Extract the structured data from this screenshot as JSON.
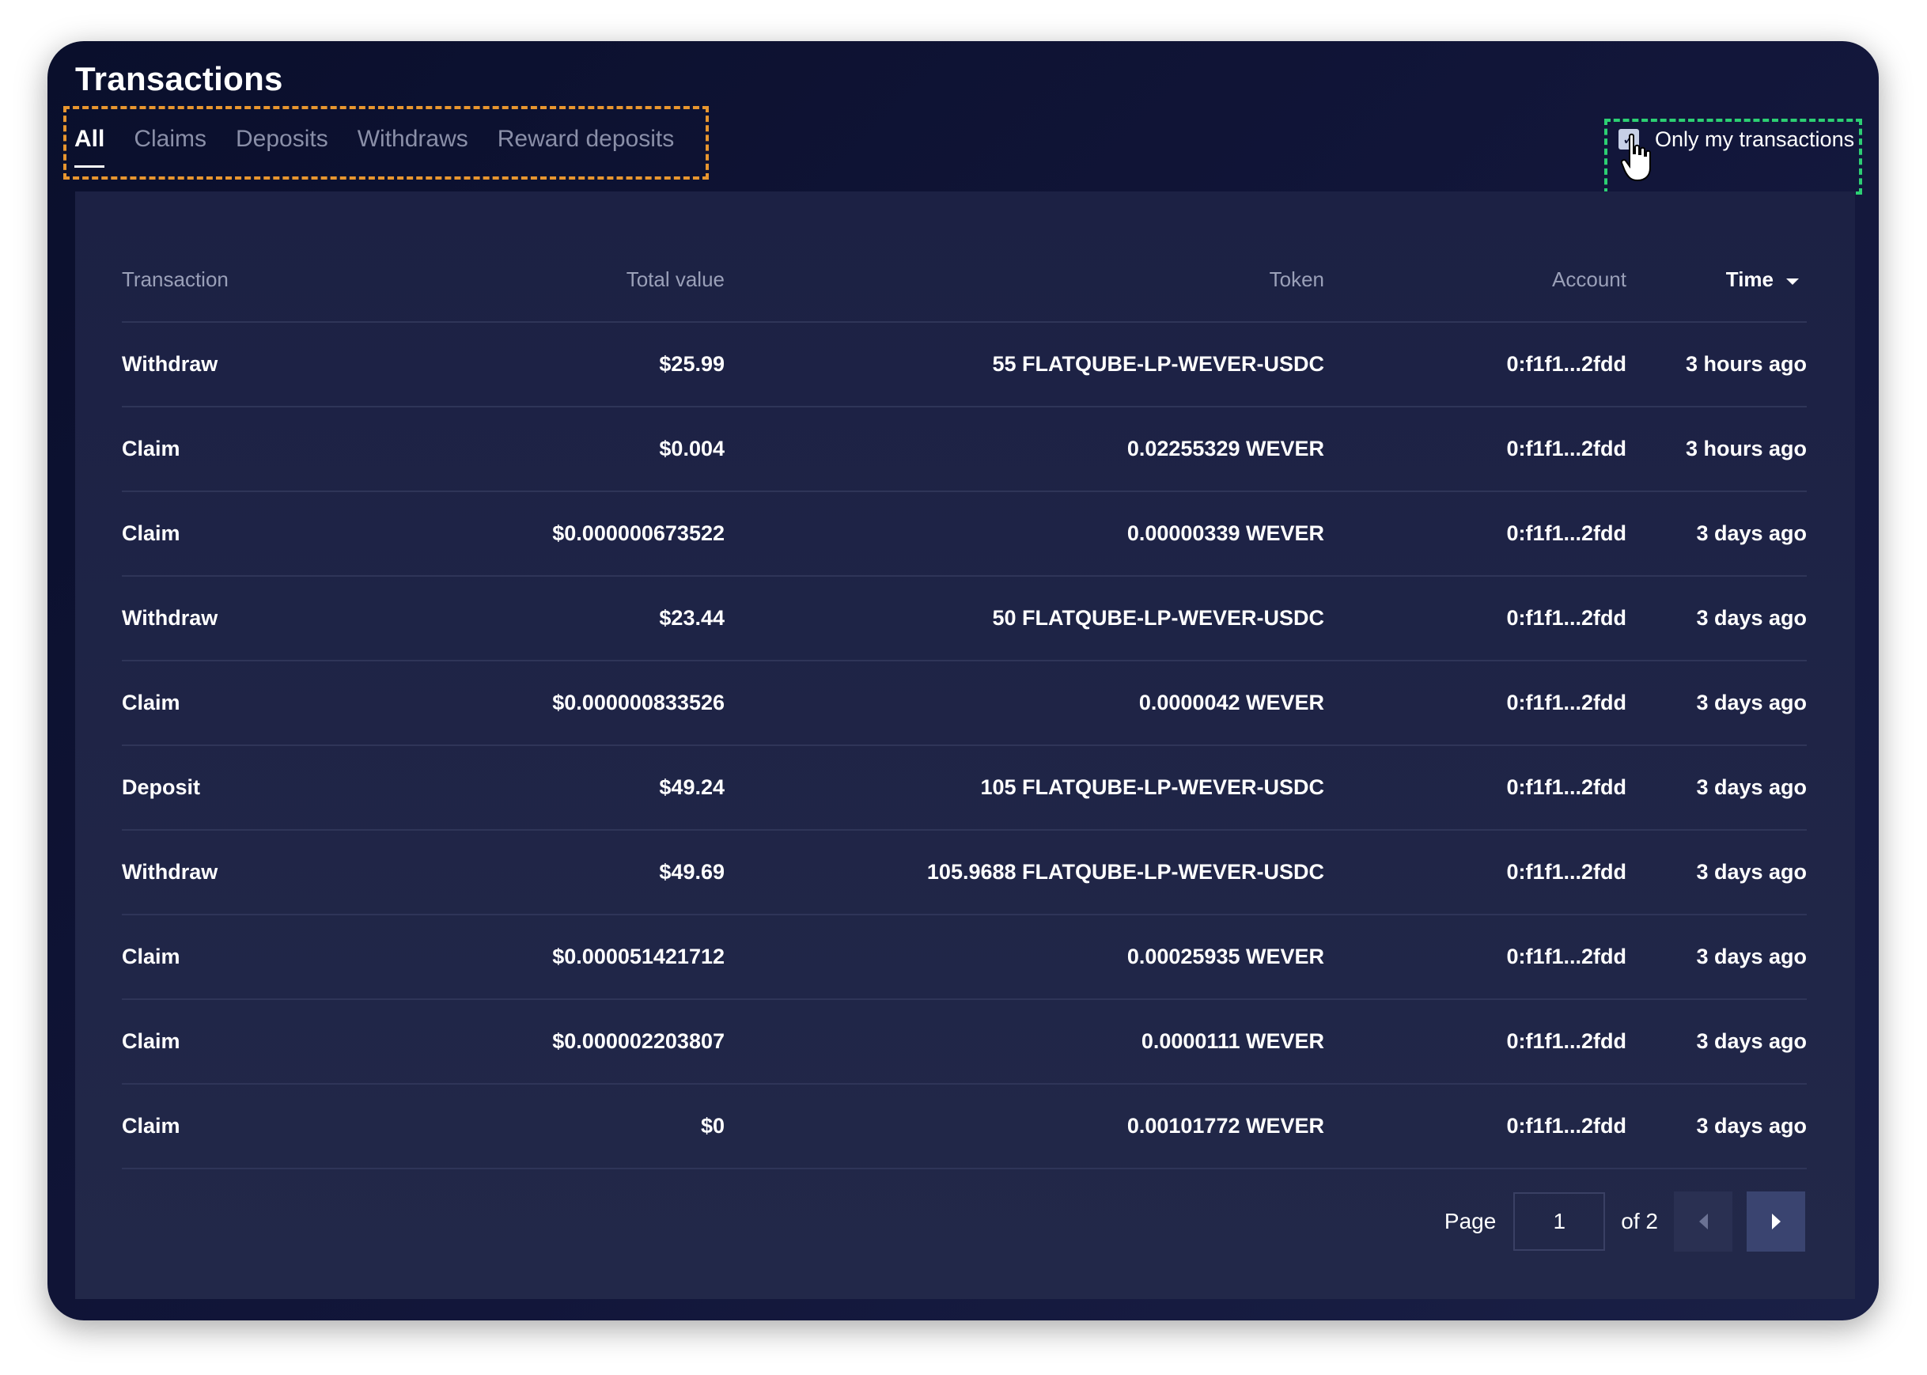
{
  "title": "Transactions",
  "tabs": [
    {
      "label": "All",
      "active": true
    },
    {
      "label": "Claims",
      "active": false
    },
    {
      "label": "Deposits",
      "active": false
    },
    {
      "label": "Withdraws",
      "active": false
    },
    {
      "label": "Reward deposits",
      "active": false
    }
  ],
  "filter": {
    "label": "Only my transactions",
    "checked": true
  },
  "table": {
    "columns": [
      "Transaction",
      "Total value",
      "Token",
      "Account",
      "Time"
    ],
    "rows": [
      [
        "Withdraw",
        "$25.99",
        "55 FLATQUBE-LP-WEVER-USDC",
        "0:f1f1...2fdd",
        "3 hours ago"
      ],
      [
        "Claim",
        "$0.004",
        "0.02255329 WEVER",
        "0:f1f1...2fdd",
        "3 hours ago"
      ],
      [
        "Claim",
        "$0.000000673522",
        "0.00000339 WEVER",
        "0:f1f1...2fdd",
        "3 days ago"
      ],
      [
        "Withdraw",
        "$23.44",
        "50 FLATQUBE-LP-WEVER-USDC",
        "0:f1f1...2fdd",
        "3 days ago"
      ],
      [
        "Claim",
        "$0.000000833526",
        "0.0000042 WEVER",
        "0:f1f1...2fdd",
        "3 days ago"
      ],
      [
        "Deposit",
        "$49.24",
        "105 FLATQUBE-LP-WEVER-USDC",
        "0:f1f1...2fdd",
        "3 days ago"
      ],
      [
        "Withdraw",
        "$49.69",
        "105.9688 FLATQUBE-LP-WEVER-USDC",
        "0:f1f1...2fdd",
        "3 days ago"
      ],
      [
        "Claim",
        "$0.000051421712",
        "0.00025935 WEVER",
        "0:f1f1...2fdd",
        "3 days ago"
      ],
      [
        "Claim",
        "$0.000002203807",
        "0.0000111 WEVER",
        "0:f1f1...2fdd",
        "3 days ago"
      ],
      [
        "Claim",
        "$0",
        "0.00101772 WEVER",
        "0:f1f1...2fdd",
        "3 days ago"
      ]
    ]
  },
  "pagination": {
    "page_label": "Page",
    "current_page": "1",
    "of_label": "of 2"
  },
  "icons": {
    "sort": "caret-down-icon",
    "check": "checkmark-icon",
    "cursor": "hand-pointer-icon",
    "prev": "chevron-left-icon",
    "next": "chevron-right-icon"
  },
  "colors": {
    "background": "#12163a",
    "panel": "#1f2447",
    "tabs_highlight": "#e8962f",
    "filter_highlight": "#2ccf73"
  }
}
